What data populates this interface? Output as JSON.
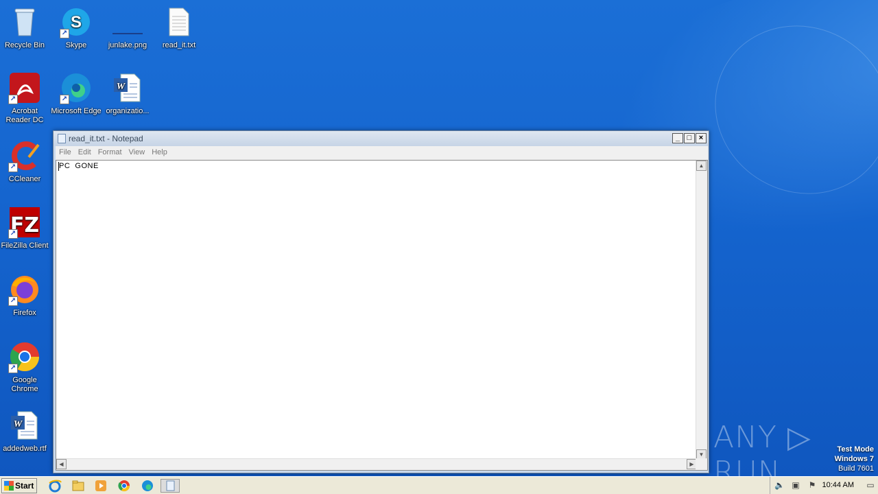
{
  "desktop": {
    "icons": {
      "recycle_bin": "Recycle Bin",
      "skype": "Skype",
      "junlake": "junlake.png",
      "read_it": "read_it.txt",
      "acrobat": "Acrobat Reader DC",
      "edge": "Microsoft Edge",
      "organization": "organizatio...",
      "ccleaner": "CCleaner",
      "filezilla": "FileZilla Client",
      "firefox": "Firefox",
      "chrome": "Google Chrome",
      "addedweb": "addedweb.rtf"
    }
  },
  "notepad": {
    "title": "read_it.txt - Notepad",
    "menu": [
      "File",
      "Edit",
      "Format",
      "View",
      "Help"
    ],
    "content": "PC  GONE",
    "buttons": {
      "minimize": "_",
      "maximize": "□",
      "close": "×"
    }
  },
  "watermark": {
    "brand": "ANY ▷ RUN"
  },
  "test_mode": {
    "line1": "Test Mode",
    "line2": "Windows 7",
    "line3": "Build 7601"
  },
  "taskbar": {
    "start_label": "Start",
    "clock": "10:44 AM",
    "pinned_icons": [
      "internet-explorer-icon",
      "file-explorer-icon",
      "media-player-icon",
      "chrome-icon",
      "edge-icon",
      "notepad-icon"
    ]
  }
}
